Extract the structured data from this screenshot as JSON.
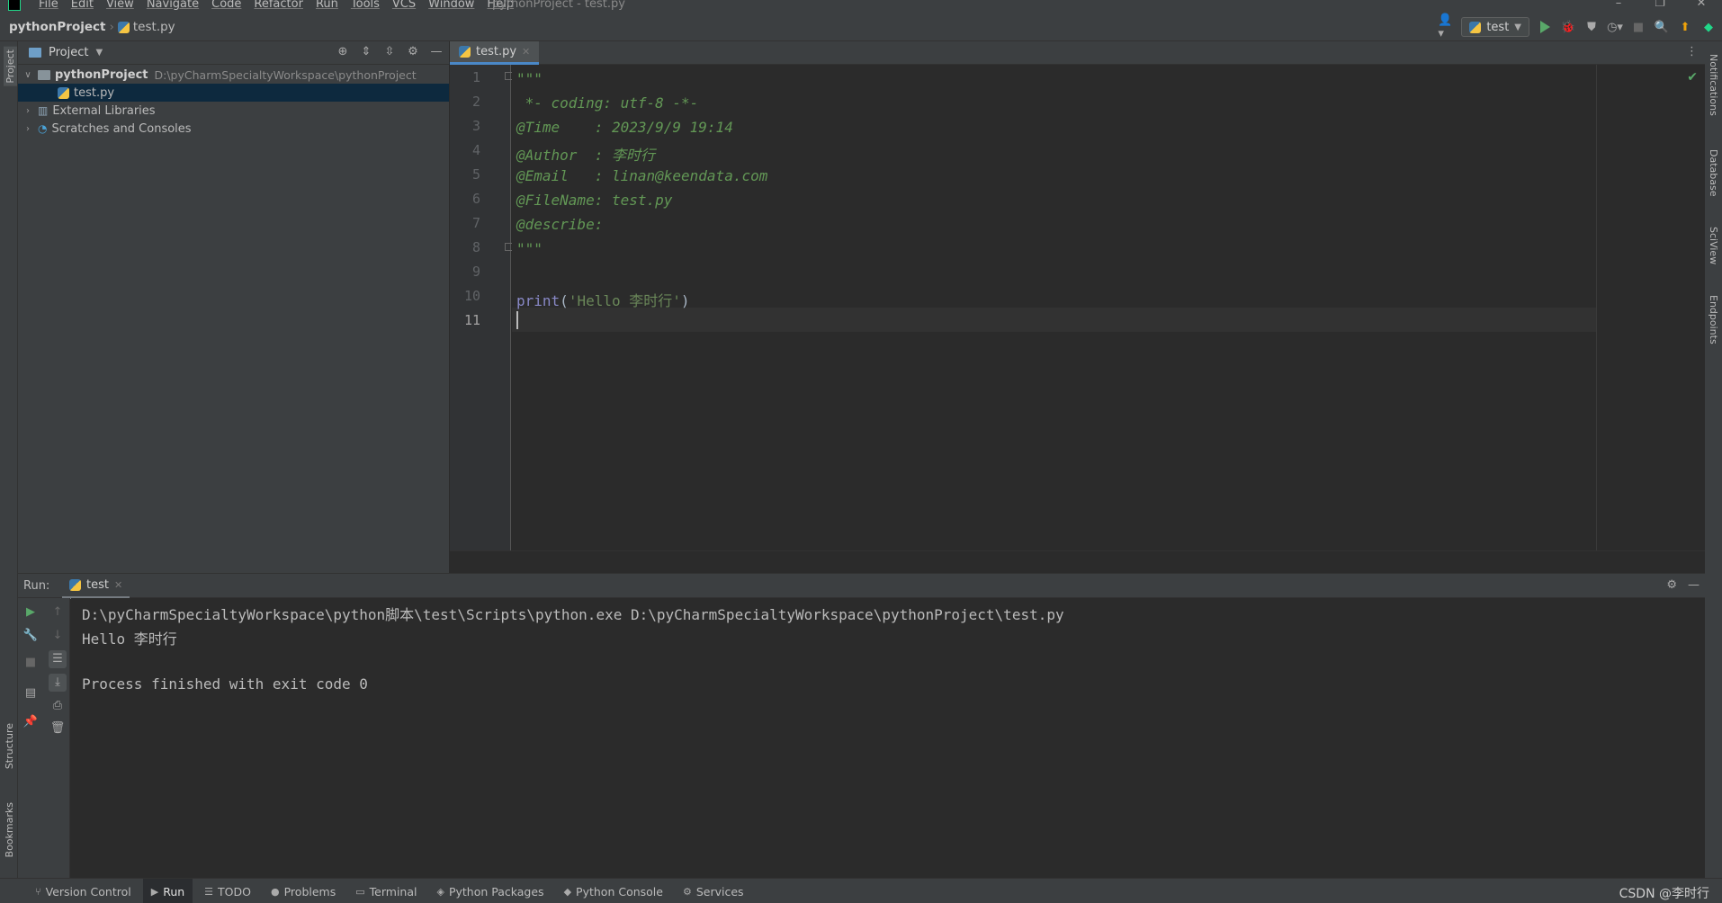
{
  "menubar": {
    "items": [
      "File",
      "Edit",
      "View",
      "Navigate",
      "Code",
      "Refactor",
      "Run",
      "Tools",
      "VCS",
      "Window",
      "Help"
    ],
    "window_title": "pythonProject - test.py"
  },
  "navbar": {
    "project": "pythonProject",
    "file": "test.py",
    "run_config": "test"
  },
  "left_stripe": {
    "project": "Project",
    "structure": "Structure",
    "bookmarks": "Bookmarks"
  },
  "right_stripe": {
    "notifications": "Notifications",
    "database": "Database",
    "sciview": "SciView",
    "endpoints": "Endpoints"
  },
  "project_pane": {
    "title": "Project",
    "root_name": "pythonProject",
    "root_path": "D:\\pyCharmSpecialtyWorkspace\\pythonProject",
    "file": "test.py",
    "external_libraries": "External Libraries",
    "scratches": "Scratches and Consoles"
  },
  "editor": {
    "tab": "test.py",
    "line_numbers": [
      "1",
      "2",
      "3",
      "4",
      "5",
      "6",
      "7",
      "8",
      "9",
      "10",
      "11"
    ],
    "lines": {
      "l1": "\"\"\"",
      "l2": " *- coding: utf-8 -*-",
      "l3": "@Time    : 2023/9/9 19:14",
      "l4": "@Author  : 李时行",
      "l5": "@Email   : linan@keendata.com",
      "l6": "@FileName: test.py",
      "l7": "@describe:",
      "l8": "\"\"\"",
      "l10_func": "print",
      "l10_open": "(",
      "l10_str": "'Hello 李时行'",
      "l10_close": ")"
    }
  },
  "run": {
    "label": "Run:",
    "tab": "test",
    "command": "D:\\pyCharmSpecialtyWorkspace\\python脚本\\test\\Scripts\\python.exe D:\\pyCharmSpecialtyWorkspace\\pythonProject\\test.py",
    "output": "Hello 李时行",
    "exit": "Process finished with exit code 0"
  },
  "statusbar": {
    "version_control": "Version Control",
    "run": "Run",
    "todo": "TODO",
    "problems": "Problems",
    "terminal": "Terminal",
    "python_packages": "Python Packages",
    "python_console": "Python Console",
    "services": "Services",
    "watermark": "CSDN @李时行"
  },
  "colors": {
    "docstring": "#629755",
    "keyword": "#8888c6",
    "string": "#6a8759",
    "selection": "#0d293e",
    "run_green": "#59a869"
  }
}
